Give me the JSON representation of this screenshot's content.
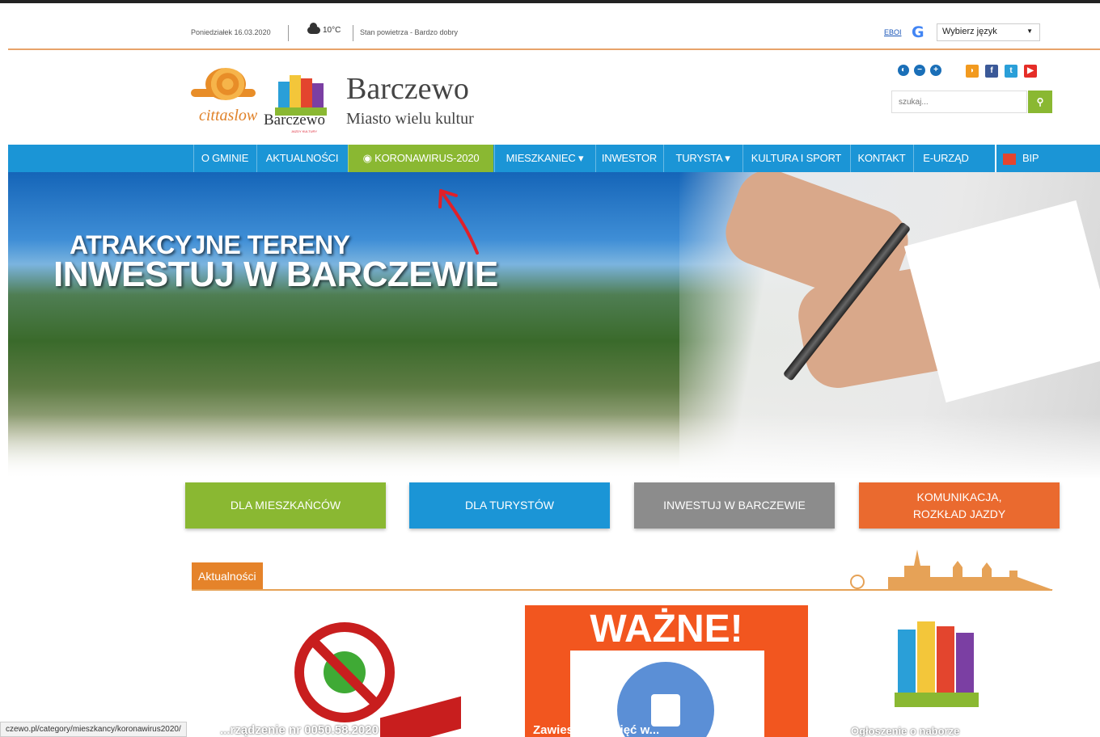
{
  "topbar": {
    "date": "Poniedziałek 16.03.2020",
    "temperature": "10°C",
    "air_quality": "Stan powietrza - Bardzo dobry",
    "ebo_link": "EBOI",
    "language_select": "Wybierz język"
  },
  "header": {
    "cittaslow_text": "cittaslow",
    "town_logo_text": "Barczewo",
    "town_logo_sub": "JAZDY KULTURY",
    "site_title": "Barczewo",
    "site_subtitle": "Miasto wielu kultur",
    "search_placeholder": "szukaj..."
  },
  "accessibility_icons": [
    "contrast-icon",
    "font-decrease-icon",
    "font-increase-icon"
  ],
  "social_icons": [
    "rss-icon",
    "facebook-icon",
    "twitter-icon",
    "youtube-icon"
  ],
  "nav": {
    "items": [
      {
        "label": "O GMINIE"
      },
      {
        "label": "AKTUALNOŚCI"
      },
      {
        "label": "◉ KORONAWIRUS-2020",
        "active": true
      },
      {
        "label": "MIESZKANIEC ▾"
      },
      {
        "label": "INWESTOR"
      },
      {
        "label": "TURYSTA ▾"
      },
      {
        "label": "KULTURA I SPORT"
      },
      {
        "label": "KONTAKT"
      },
      {
        "label": "E-URZĄD"
      },
      {
        "label": "BIP"
      }
    ]
  },
  "hero": {
    "line1": "ATRAKCYJNE TERENY",
    "line2": "INWESTUJ W BARCZEWIE"
  },
  "tiles": [
    {
      "label": "DLA MIESZKAŃCÓW",
      "color": "#8ab832"
    },
    {
      "label": "DLA TURYSTÓW",
      "color": "#1b95d6"
    },
    {
      "label": "INWESTUJ W BARCZEWIE",
      "color": "#8c8c8c"
    },
    {
      "label": "KOMUNIKACJA, ROZKŁAD JAZDY",
      "color": "#ea6a2f"
    }
  ],
  "news": {
    "section_label": "Aktualności",
    "cards": [
      {
        "caption": "...rządzenie nr 0050.58.2020"
      },
      {
        "banner": "WAŻNE!",
        "caption": "Zawieszenie zajęć w..."
      },
      {
        "caption": "Ogłoszenie o naborze"
      }
    ]
  },
  "status_bar": {
    "url": "czewo.pl/category/mieszkancy/koronawirus2020/"
  }
}
